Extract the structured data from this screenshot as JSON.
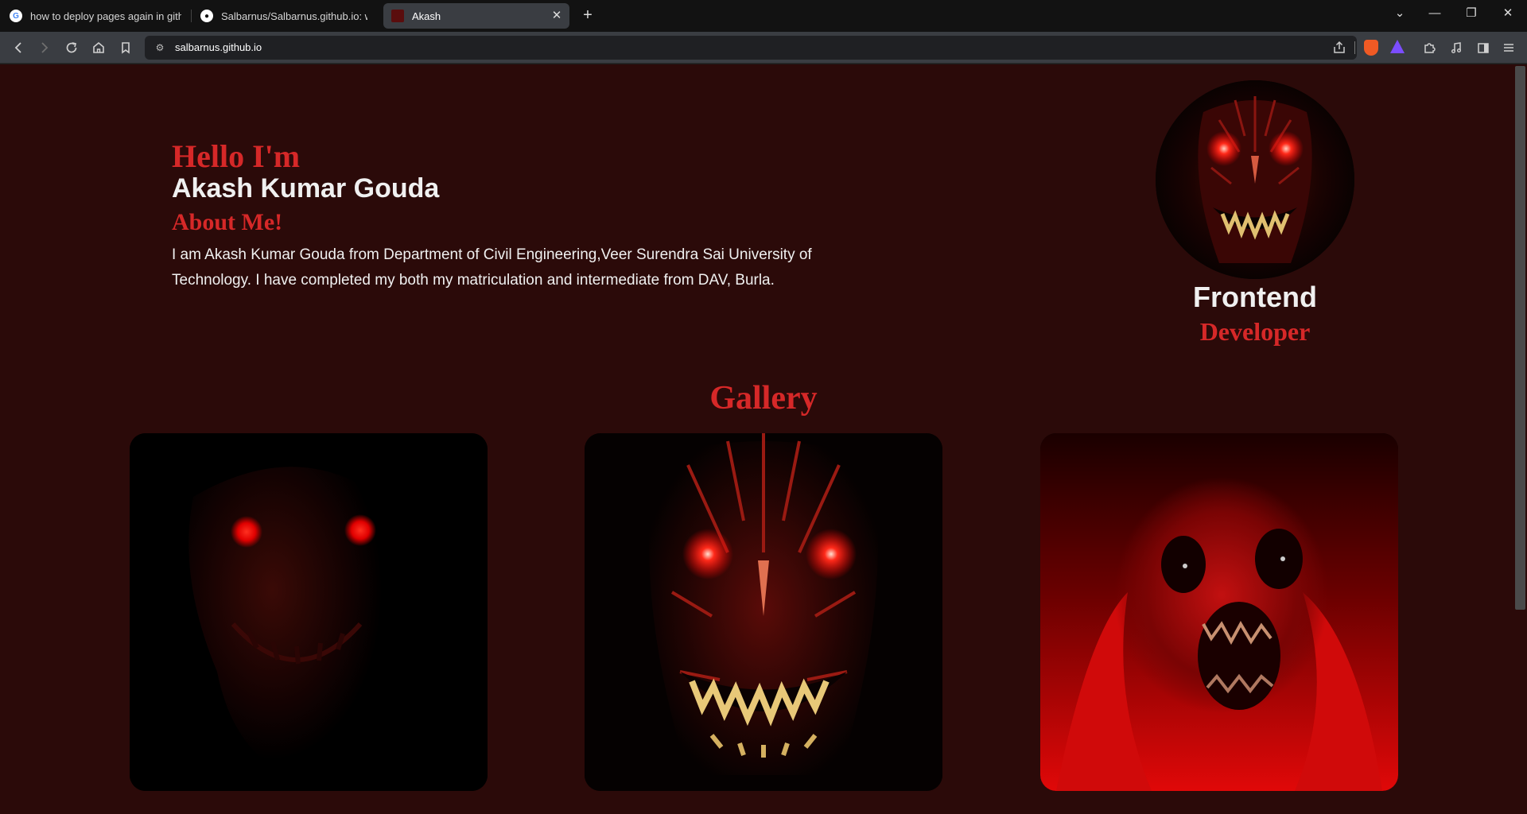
{
  "browser": {
    "tabs": [
      {
        "label": "how to deploy pages again in github"
      },
      {
        "label": "Salbarnus/Salbarnus.github.io: websi"
      },
      {
        "label": "Akash",
        "active": true
      }
    ],
    "url": "salbarnus.github.io",
    "icons": {
      "back": "arrow-left-icon",
      "forward": "arrow-right-icon",
      "reload": "reload-icon",
      "home": "home-icon",
      "bookmark": "bookmark-icon",
      "site_info": "site-settings-icon",
      "share": "share-icon",
      "shields": "brave-shields-icon",
      "rewards": "brave-rewards-icon",
      "extensions": "extensions-icon",
      "media": "media-icon",
      "sidebar": "sidebar-icon",
      "menu": "menu-icon"
    },
    "colors": {
      "tabbar_bg": "#121212",
      "toolbar_bg": "#3a3d42"
    }
  },
  "hero": {
    "greeting": "Hello I'm",
    "name": "Akash Kumar Gouda",
    "about_title": "About Me!",
    "about_text": "I am Akash Kumar Gouda from Department of Civil Engineering,Veer Surendra Sai University of Technology. I have completed my both my matriculation and intermediate from DAV, Burla.",
    "role_primary": "Frontend",
    "role_secondary": "Developer"
  },
  "gallery": {
    "title": "Gallery",
    "items": [
      {
        "image": "red-eyed-skull"
      },
      {
        "image": "grinning-veined-face"
      },
      {
        "image": "screaming-red-ghoul"
      }
    ]
  },
  "colors": {
    "page_bg": "#2b0a09",
    "accent": "#d62828",
    "text": "#f0f0f0"
  }
}
